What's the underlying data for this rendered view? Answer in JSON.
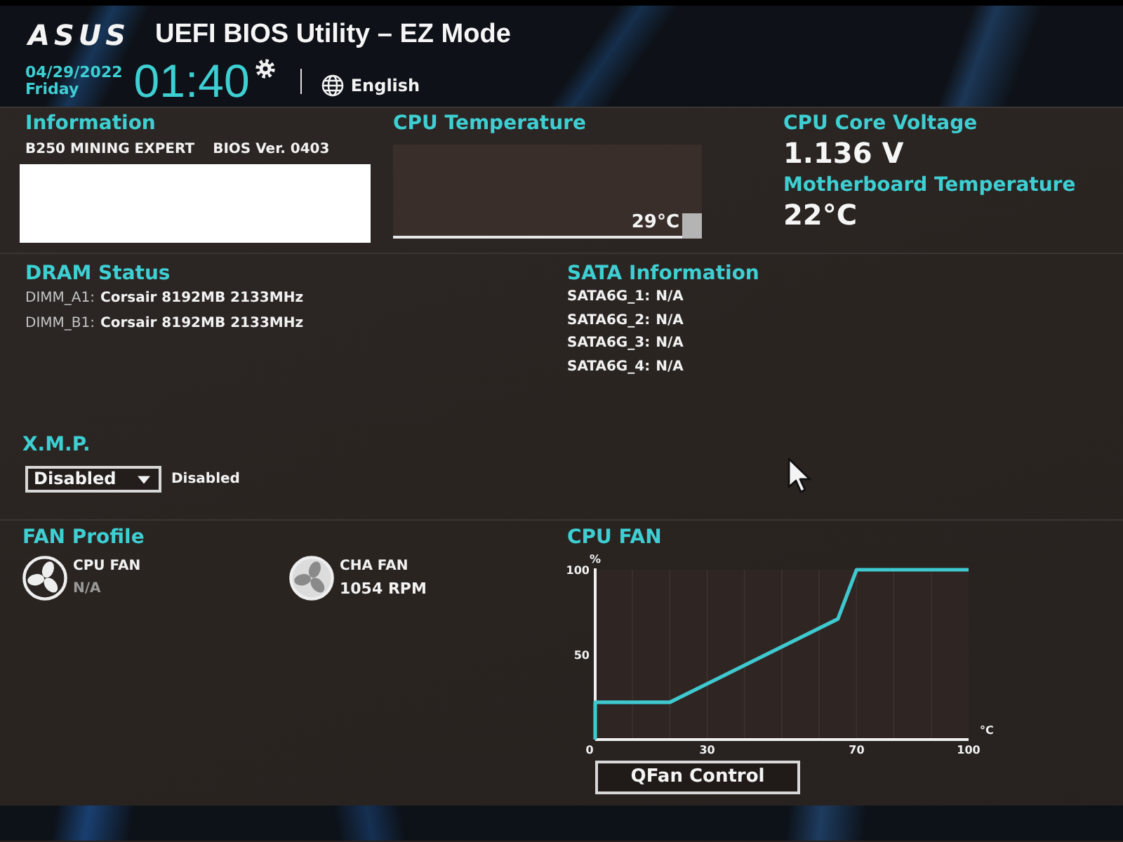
{
  "header": {
    "logo": "ASUS",
    "title": "UEFI BIOS Utility – EZ Mode",
    "date": "04/29/2022",
    "weekday": "Friday",
    "time": "01:40",
    "language": "English"
  },
  "information": {
    "title": "Information",
    "model": "B250 MINING EXPERT",
    "bios_version": "BIOS Ver. 0403"
  },
  "cpu_temperature": {
    "title": "CPU Temperature",
    "reading": "29°C"
  },
  "cpu_core_voltage": {
    "title": "CPU Core Voltage",
    "reading": "1.136 V"
  },
  "motherboard_temperature": {
    "title": "Motherboard Temperature",
    "reading": "22°C"
  },
  "dram_status": {
    "title": "DRAM Status",
    "slots": [
      {
        "name": "DIMM_A1:",
        "value": "Corsair 8192MB 2133MHz"
      },
      {
        "name": "DIMM_B1:",
        "value": "Corsair 8192MB 2133MHz"
      }
    ]
  },
  "sata_information": {
    "title": "SATA Information",
    "ports": [
      {
        "name": "SATA6G_1:",
        "value": "N/A"
      },
      {
        "name": "SATA6G_2:",
        "value": "N/A"
      },
      {
        "name": "SATA6G_3:",
        "value": "N/A"
      },
      {
        "name": "SATA6G_4:",
        "value": "N/A"
      }
    ]
  },
  "xmp": {
    "title": "X.M.P.",
    "value": "Disabled",
    "status": "Disabled"
  },
  "fan_profile": {
    "title": "FAN Profile",
    "fans": [
      {
        "name": "CPU FAN",
        "reading": "N/A",
        "active": false
      },
      {
        "name": "CHA FAN",
        "reading": "1054 RPM",
        "active": true
      }
    ]
  },
  "cpu_fan": {
    "title": "CPU FAN",
    "chart_data": {
      "type": "line",
      "xlabel": "°C",
      "ylabel": "%",
      "x": [
        0,
        0,
        20,
        65,
        70,
        100
      ],
      "values": [
        0,
        22,
        22,
        71,
        100,
        100
      ],
      "xlim": [
        0,
        100
      ],
      "ylim": [
        0,
        100
      ],
      "xticks": [
        0,
        30,
        70,
        100
      ],
      "yticks": [
        50,
        100
      ]
    },
    "button": "QFan Control"
  }
}
